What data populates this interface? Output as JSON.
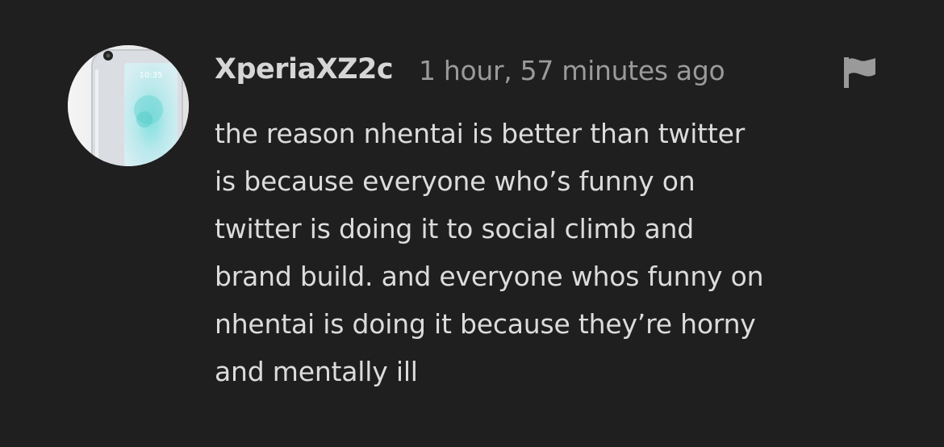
{
  "comment": {
    "username": "XperiaXZ2c",
    "timestamp": "1 hour, 57 minutes ago",
    "avatar_clock": "10:35",
    "flag_icon": "flag-icon",
    "body_lines": [
      "the reason nhentai is better than twitter",
      "is because everyone who’s funny on",
      "twitter is doing it to social climb and",
      "brand build. and everyone whos funny on",
      "nhentai is doing it because they’re horny",
      "and mentally ill"
    ]
  },
  "colors": {
    "background": "#1f1f1f",
    "username": "#d6d6d6",
    "timestamp": "#9a9a9a",
    "body": "#dcdcdc",
    "flag": "#9a9a9a"
  }
}
